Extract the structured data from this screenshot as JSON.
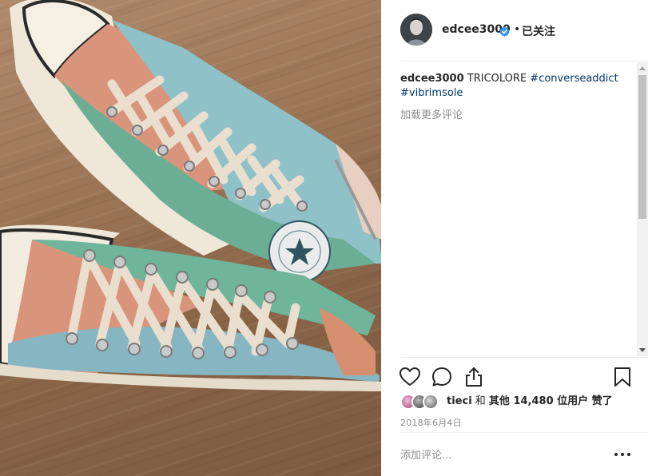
{
  "post": {
    "author": {
      "username": "edcee3000",
      "verified": true,
      "follow_separator": "•",
      "follow_label": "已关注"
    },
    "caption": {
      "username": "edcee3000",
      "text": " TRICOLORE ",
      "hashtags": [
        "#converseaddict",
        "#vibrimsole"
      ]
    },
    "load_more_comments": "加载更多评论",
    "likes": {
      "first_user": "tieci",
      "conjunction": " 和 ",
      "others_label": "其他 14,480 位用户",
      "suffix": " 赞了"
    },
    "date": "2018年6月4日",
    "comment_placeholder": "添加评论...",
    "more_icon": "more-options-icon"
  },
  "icons": [
    "heart-icon",
    "comment-icon",
    "share-icon",
    "bookmark-icon",
    "verified-badge-icon"
  ],
  "colors": {
    "verified_badge": "#3897f0",
    "hashtag": "#00376b",
    "muted_text": "#8e8e8e"
  }
}
